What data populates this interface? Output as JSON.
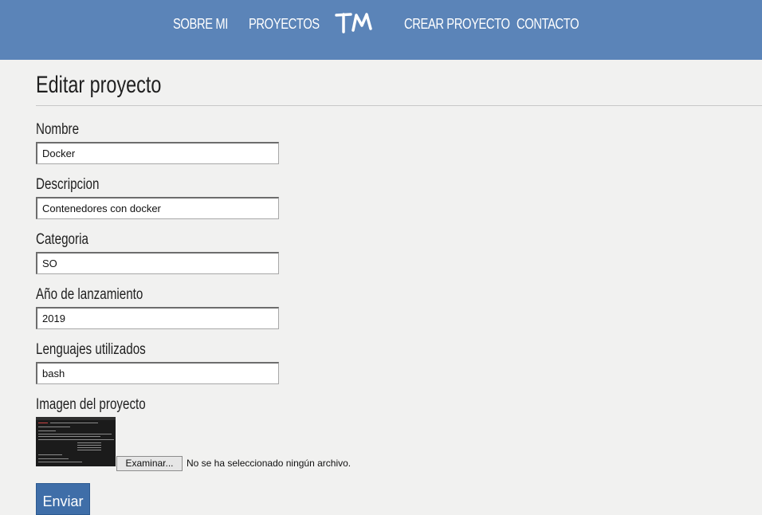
{
  "nav": {
    "items": [
      "SOBRE MI",
      "PROYECTOS",
      "CREAR PROYECTO",
      "CONTACTO"
    ],
    "logo_text": "TM"
  },
  "page": {
    "title": "Editar proyecto"
  },
  "form": {
    "fields": [
      {
        "label": "Nombre",
        "value": "Docker"
      },
      {
        "label": "Descripcion",
        "value": "Contenedores con docker"
      },
      {
        "label": "Categoria",
        "value": "SO"
      },
      {
        "label": "Año de lanzamiento",
        "value": "2019"
      },
      {
        "label": "Lenguajes utilizados",
        "value": "bash"
      }
    ],
    "image_label": "Imagen del proyecto",
    "file_button": "Examinar...",
    "file_status": "No se ha seleccionado ningún archivo.",
    "submit": "Enviar"
  },
  "colors": {
    "header": "#5b84b8",
    "submit": "#3f6ea8",
    "background": "#f1f1f0"
  }
}
